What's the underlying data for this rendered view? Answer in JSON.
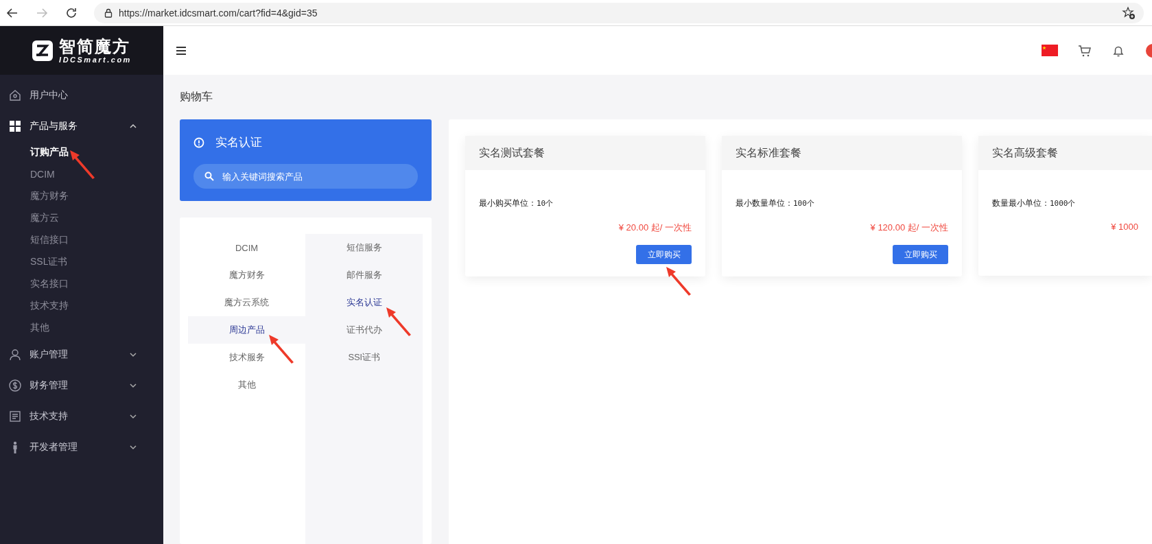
{
  "browser": {
    "url": "https://market.idcsmart.com/cart?fid=4&gid=35",
    "forward_disabled": true
  },
  "sidebar": {
    "logo_title": "智简魔方",
    "logo_subtitle": "IDCSmart.com",
    "items": [
      {
        "label": "用户中心",
        "kind": "link",
        "selected": false
      },
      {
        "label": "产品与服务",
        "kind": "group",
        "selected": true,
        "expanded": true,
        "children": [
          {
            "label": "订购产品",
            "selected": true,
            "annotated": true
          },
          {
            "label": "DCIM",
            "selected": false
          },
          {
            "label": "魔方财务",
            "selected": false
          },
          {
            "label": "魔方云",
            "selected": false
          },
          {
            "label": "短信接口",
            "selected": false
          },
          {
            "label": "SSL证书",
            "selected": false
          },
          {
            "label": "实名接口",
            "selected": false
          },
          {
            "label": "技术支持",
            "selected": false
          },
          {
            "label": "其他",
            "selected": false
          }
        ]
      },
      {
        "label": "账户管理",
        "kind": "group",
        "selected": false,
        "expanded": false
      },
      {
        "label": "财务管理",
        "kind": "group",
        "selected": false,
        "expanded": false
      },
      {
        "label": "技术支持",
        "kind": "group",
        "selected": false,
        "expanded": false
      },
      {
        "label": "开发者管理",
        "kind": "group",
        "selected": false,
        "expanded": false
      }
    ]
  },
  "page_title": "购物车",
  "category_card": {
    "title": "实名认证",
    "search": {
      "placeholder": "输入关键词搜索产品"
    }
  },
  "categories": {
    "primary": [
      {
        "label": "DCIM",
        "selected": false
      },
      {
        "label": "魔方财务",
        "selected": false
      },
      {
        "label": "魔方云系统",
        "selected": false
      },
      {
        "label": "周边产品",
        "selected": true,
        "annotated": true
      },
      {
        "label": "技术服务",
        "selected": false
      },
      {
        "label": "其他",
        "selected": false
      }
    ],
    "secondary": [
      {
        "label": "短信服务",
        "selected": false
      },
      {
        "label": "邮件服务",
        "selected": false
      },
      {
        "label": "实名认证",
        "selected": true,
        "annotated": true
      },
      {
        "label": "证书代办",
        "selected": false
      },
      {
        "label": "SSl证书",
        "selected": false
      }
    ]
  },
  "products": [
    {
      "title": "实名测试套餐",
      "spec_label": "最小购买单位：",
      "spec_value": "10个",
      "price": "¥ 20.00 起/ 一次性",
      "button": "立即购买",
      "annotated": true
    },
    {
      "title": "实名标准套餐",
      "spec_label": "最小数量单位：",
      "spec_value": "100个",
      "price": "¥ 120.00 起/ 一次性",
      "button": "立即购买",
      "annotated": false
    },
    {
      "title": "实名高级套餐",
      "spec_label": "数量最小单位：",
      "spec_value": "1000个",
      "price": "¥ 1000"
    }
  ]
}
